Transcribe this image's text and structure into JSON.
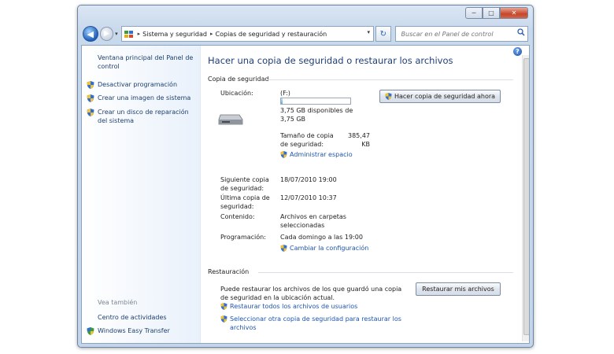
{
  "window": {
    "caption_min": "─",
    "caption_max": "□",
    "caption_close": "✕"
  },
  "nav": {
    "back_glyph": "◀",
    "forward_glyph": "▶",
    "recent_glyph": "▾",
    "breadcrumbs": [
      "Sistema y seguridad",
      "Copias de seguridad y restauración"
    ],
    "separator": "▸",
    "dropdown_glyph": "▾",
    "refresh_glyph": "↻",
    "search_placeholder": "Buscar en el Panel de control",
    "search_icon": "search-icon"
  },
  "sidebar": {
    "home": "Ventana principal del Panel de control",
    "links": [
      {
        "label": "Desactivar programación",
        "icon": "shield-icon"
      },
      {
        "label": "Crear una imagen de sistema",
        "icon": "shield-icon"
      },
      {
        "label": "Crear un disco de reparación del sistema",
        "icon": "shield-icon"
      }
    ],
    "see_also": "Vea también",
    "see_also_links": [
      {
        "label": "Centro de actividades"
      },
      {
        "label": "Windows Easy Transfer",
        "icon": "shield-icon"
      }
    ]
  },
  "help_glyph": "?",
  "main": {
    "title": "Hacer una copia de seguridad o restaurar los archivos",
    "backup": {
      "heading": "Copia de seguridad",
      "location_label": "Ubicación:",
      "location_value": "(F:)",
      "free_space": "3,75 GB disponibles de 3,75 GB",
      "used_fraction": 0.02,
      "size_label": "Tamaño de copia de seguridad:",
      "size_value": "385,47 KB",
      "manage_space": "Administrar espacio",
      "backup_now": "Hacer copia de seguridad ahora",
      "rows": [
        {
          "label": "Siguiente copia de seguridad:",
          "value": "18/07/2010 19:00"
        },
        {
          "label": "Última copia de seguridad:",
          "value": "12/07/2010 10:37"
        },
        {
          "label": "Contenido:",
          "value": "Archivos en carpetas seleccionadas"
        },
        {
          "label": "Programación:",
          "value": "Cada domingo a las 19:00"
        }
      ],
      "change_settings": "Cambiar la configuración"
    },
    "restore": {
      "heading": "Restauración",
      "description": "Puede restaurar los archivos de los que guardó una copia de seguridad en la ubicación actual.",
      "restore_button": "Restaurar mis archivos",
      "restore_all_users": "Restaurar todos los archivos de usuarios",
      "select_other": "Seleccionar otra copia de seguridad para restaurar los archivos"
    }
  },
  "colors": {
    "link": "#1d55b0",
    "title": "#1e3f7a",
    "shield_blue": "#2f6fd6",
    "shield_yellow": "#f2c230"
  }
}
